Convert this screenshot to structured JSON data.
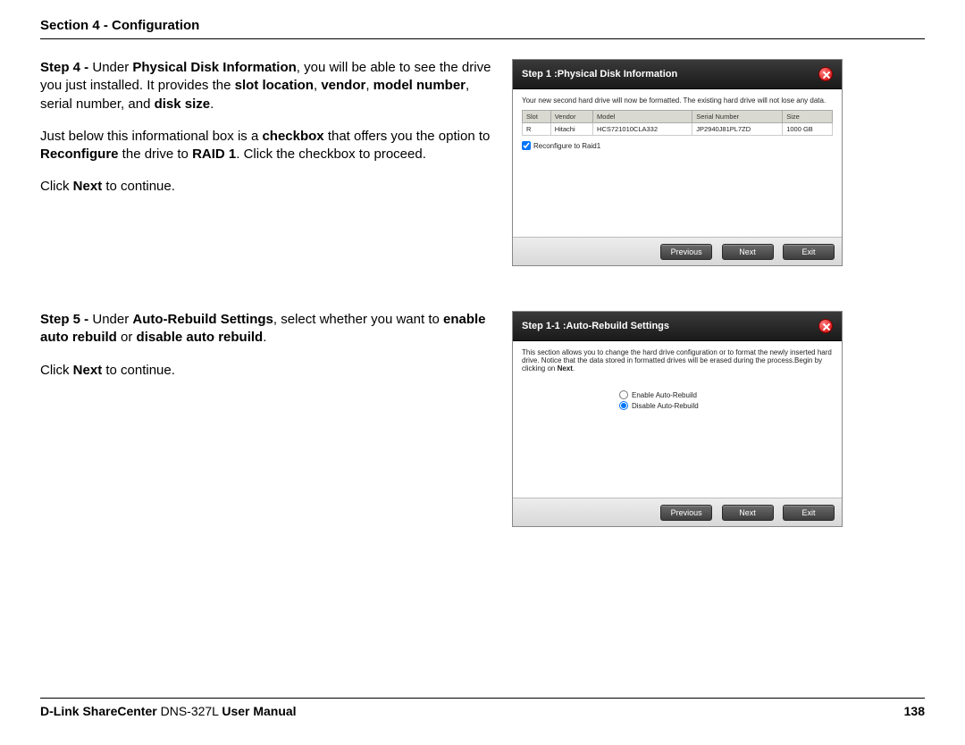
{
  "section_header": "Section 4 - Configuration",
  "step4": {
    "prefix": "Step 4 - ",
    "t1a": "Under ",
    "bold1": "Physical Disk Information",
    "t1b": ", you will be able to see the drive you just installed. It provides the ",
    "bold2": "slot location",
    "t1c": ", ",
    "bold3": "vendor",
    "t1d": ", ",
    "bold4": "model number",
    "t1e": ", serial number, and ",
    "bold5": "disk size",
    "t1f": ".",
    "p2a": "Just below this informational box is a ",
    "p2b": "checkbox",
    "p2c": " that offers you the option to ",
    "p2d": "Reconfigure",
    "p2e": " the drive to ",
    "p2f": "RAID 1",
    "p2g": ". Click the checkbox to proceed.",
    "p3a": "Click ",
    "p3b": "Next",
    "p3c": " to continue.",
    "panel_title": "Step 1 :Physical Disk Information",
    "panel_desc": "Your new second hard drive will now be formatted. The existing hard drive will not lose any data.",
    "th_slot": "Slot",
    "th_vendor": "Vendor",
    "th_model": "Model",
    "th_serial": "Serial Number",
    "th_size": "Size",
    "td_slot": "R",
    "td_vendor": "Hitachi",
    "td_model": "HCS721010CLA332",
    "td_serial": "JP2940J81PL7ZD",
    "td_size": "1000 GB",
    "chk_label": "Reconfigure to Raid1"
  },
  "step5": {
    "prefix": "Step 5 - ",
    "t1a": "Under ",
    "bold1": "Auto-Rebuild Settings",
    "t1b": ", select whether you want to ",
    "bold2": "enable auto rebuild",
    "t1c": " or ",
    "bold3": "disable auto rebuild",
    "t1d": ".",
    "p2a": "Click ",
    "p2b": "Next",
    "p2c": " to continue.",
    "panel_title": "Step 1-1 :Auto-Rebuild Settings",
    "panel_desc_a": "This section allows you to change the hard drive configuration or to format the newly inserted hard drive. Notice that the data stored in formatted drives will be erased during the process.Begin by clicking on ",
    "panel_desc_b": "Next",
    "panel_desc_c": ".",
    "opt_enable": "Enable Auto-Rebuild",
    "opt_disable": "Disable Auto-Rebuild"
  },
  "buttons": {
    "previous": "Previous",
    "next": "Next",
    "exit": "Exit"
  },
  "footer": {
    "brand_b1": "D-Link ShareCenter",
    "brand_light": " DNS-327L ",
    "brand_b2": "User Manual",
    "page": "138"
  }
}
